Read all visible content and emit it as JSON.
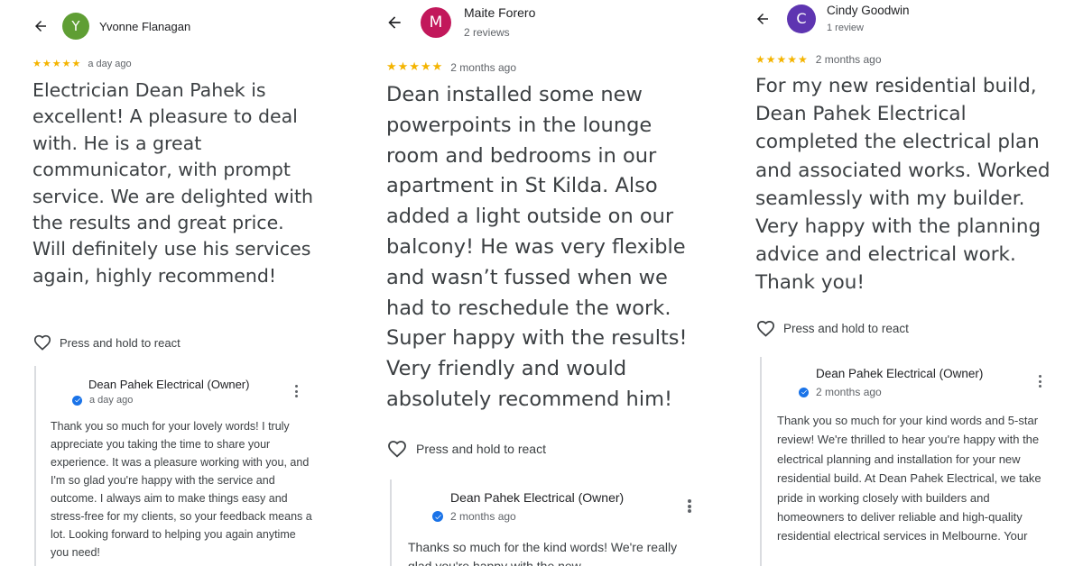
{
  "reviews": [
    {
      "reviewer_name": "Yvonne Flanagan",
      "reviewer_meta": "",
      "avatar_initial": "Y",
      "avatar_color": "#5f9e34",
      "stars": "★★★★★",
      "rating": 5,
      "date": "a day ago",
      "text": "Electrician Dean Pahek is excellent! A pleasure to deal with. He is a great communicator, with prompt service. We are delighted with the results and great price. Will definitely use his services again, highly recommend!",
      "react_label": "Press and hold to react",
      "owner_name": "Dean Pahek Electrical (Owner)",
      "owner_date": "a day ago",
      "owner_text": "Thank you so much for your lovely words! I truly appreciate you taking the time to share your experience. It was a pleasure working with you, and I'm so glad you're happy with the service and outcome. I always aim to make things easy and stress-free for my clients, so your feedback means a lot. Looking forward to helping you again anytime you need!"
    },
    {
      "reviewer_name": "Maite Forero",
      "reviewer_meta": "2 reviews",
      "avatar_initial": "M",
      "avatar_color": "#c2185b",
      "stars": "★★★★★",
      "rating": 5,
      "date": "2 months ago",
      "text": "Dean installed some new powerpoints in the lounge room and bedrooms in our apartment in St Kilda. Also added a light outside on our balcony! He was very flexible and wasn’t fussed when we had to reschedule the work. Super happy with the results! Very friendly and would absolutely recommend him!",
      "react_label": "Press and hold to react",
      "owner_name": "Dean Pahek Electrical (Owner)",
      "owner_date": "2 months ago",
      "owner_text": "Thanks so much for the kind words! We're really glad you're happy with the new"
    },
    {
      "reviewer_name": "Cindy Goodwin",
      "reviewer_meta": "1 review",
      "avatar_initial": "C",
      "avatar_color": "#5e35b1",
      "stars": "★★★★★",
      "rating": 5,
      "date": "2 months ago",
      "text": "For my new residential build, Dean Pahek Electrical completed the electrical plan and associated works. Worked seamlessly with my builder. Very happy with the planning advice and electrical work. Thank you!",
      "react_label": "Press and hold to react",
      "owner_name": "Dean Pahek Electrical (Owner)",
      "owner_date": "2 months ago",
      "owner_text": "Thank you so much for your kind words and 5-star review! We're thrilled to hear you're happy with the electrical planning and installation for your new residential build. At Dean Pahek Electrical, we take pride in working closely with builders and homeowners to deliver reliable and high-quality residential electrical services in Melbourne. Your"
    }
  ]
}
